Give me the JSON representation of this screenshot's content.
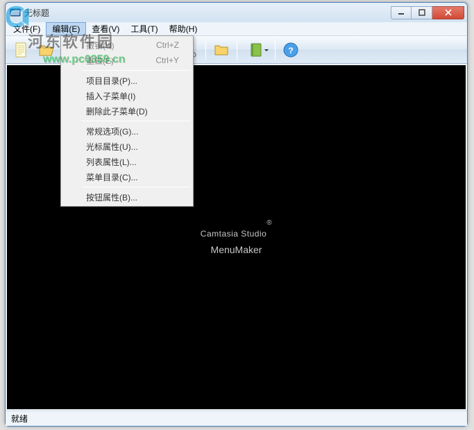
{
  "window": {
    "title": "无标题"
  },
  "watermark": {
    "site_name": "河东软件园",
    "url": "www.pc0359.cn"
  },
  "menubar": {
    "items": [
      {
        "label": "文件(F)"
      },
      {
        "label": "编辑(E)"
      },
      {
        "label": "查看(V)"
      },
      {
        "label": "工具(T)"
      },
      {
        "label": "帮助(H)"
      }
    ]
  },
  "dropdown": {
    "items": [
      {
        "label": "撤销(U)",
        "shortcut": "Ctrl+Z",
        "disabled": true
      },
      {
        "label": "重做(E)",
        "shortcut": "Ctrl+Y",
        "disabled": true
      },
      {
        "sep": true
      },
      {
        "label": "项目目录(P)..."
      },
      {
        "label": "插入子菜单(I)"
      },
      {
        "label": "删除此子菜单(D)"
      },
      {
        "sep": true
      },
      {
        "label": "常规选项(G)..."
      },
      {
        "label": "光标属性(U)..."
      },
      {
        "label": "列表属性(L)..."
      },
      {
        "label": "菜单目录(C)..."
      },
      {
        "sep": true
      },
      {
        "label": "按钮属性(B)..."
      }
    ]
  },
  "content": {
    "brand_title": "Camtasia Studio",
    "brand_sub": "MenuMaker",
    "reg": "®"
  },
  "statusbar": {
    "text": "就绪"
  }
}
